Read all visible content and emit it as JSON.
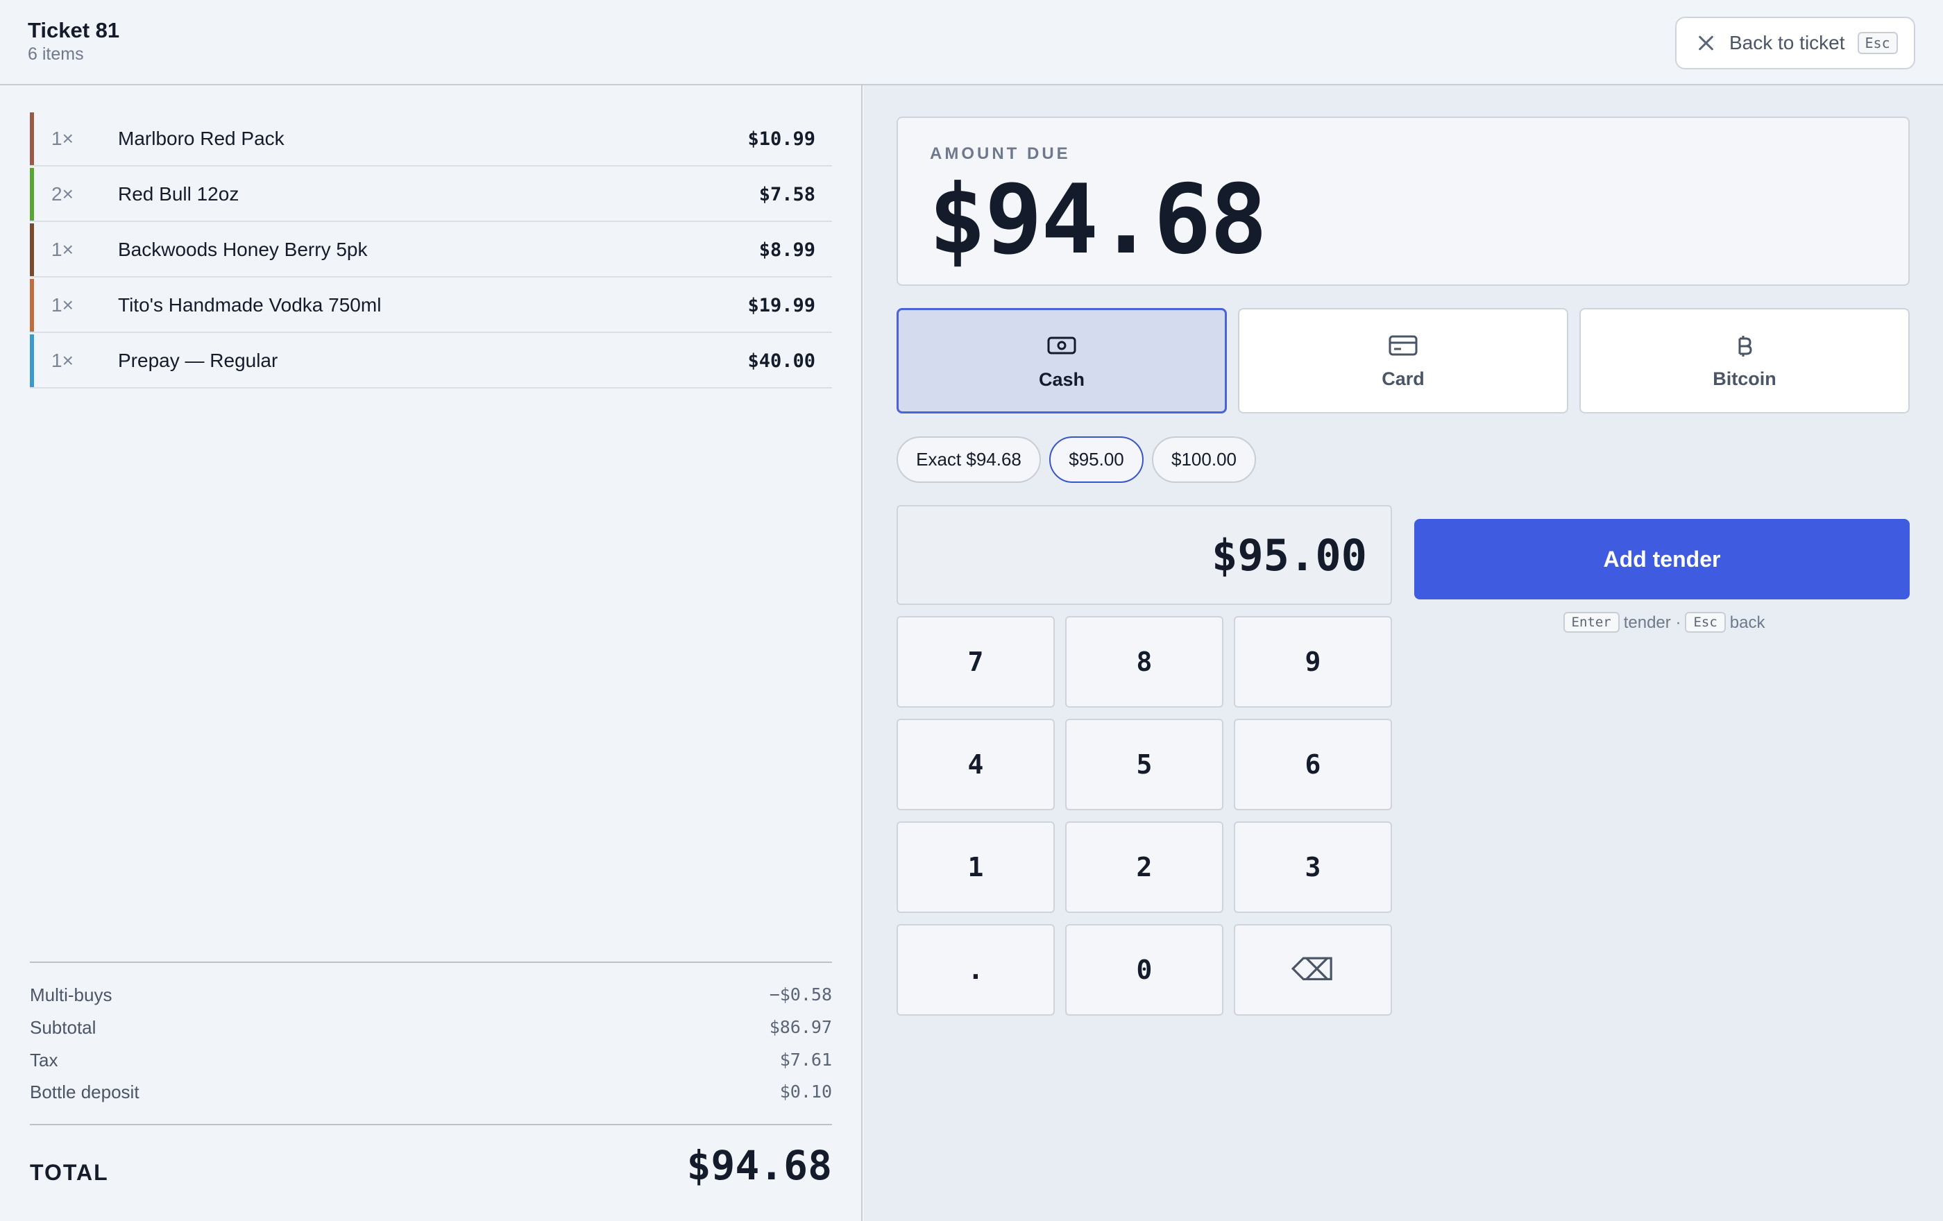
{
  "header": {
    "title": "Ticket 81",
    "subtitle": "6 items",
    "back_label": "Back to ticket",
    "back_key": "Esc"
  },
  "items": [
    {
      "qty": "1×",
      "name": "Marlboro Red Pack",
      "price": "$10.99",
      "color": "#9a5a48"
    },
    {
      "qty": "2×",
      "name": "Red Bull 12oz",
      "price": "$7.58",
      "color": "#5aa632"
    },
    {
      "qty": "1×",
      "name": "Backwoods Honey Berry 5pk",
      "price": "$8.99",
      "color": "#7a4a2c"
    },
    {
      "qty": "1×",
      "name": "Tito's Handmade Vodka 750ml",
      "price": "$19.99",
      "color": "#c26d3e"
    },
    {
      "qty": "1×",
      "name": "Prepay — Regular",
      "price": "$40.00",
      "color": "#3a9ad0"
    }
  ],
  "summary": {
    "multibuys_label": "Multi-buys",
    "multibuys_value": "−$0.58",
    "subtotal_label": "Subtotal",
    "subtotal_value": "$86.97",
    "tax_label": "Tax",
    "tax_value": "$7.61",
    "deposit_label": "Bottle deposit",
    "deposit_value": "$0.10",
    "total_label": "TOTAL",
    "total_value": "$94.68"
  },
  "amount_due": {
    "label": "AMOUNT DUE",
    "value": "$94.68"
  },
  "methods": [
    {
      "label": "Cash",
      "icon": "cash-icon",
      "selected": true
    },
    {
      "label": "Card",
      "icon": "card-icon",
      "selected": false
    },
    {
      "label": "Bitcoin",
      "icon": "bitcoin-icon",
      "selected": false
    }
  ],
  "quick_amounts": [
    {
      "label": "Exact $94.68",
      "selected": false
    },
    {
      "label": "$95.00",
      "selected": true
    },
    {
      "label": "$100.00",
      "selected": false
    }
  ],
  "entry_value": "$95.00",
  "keypad": [
    "7",
    "8",
    "9",
    "4",
    "5",
    "6",
    "1",
    "2",
    "3",
    ".",
    "0",
    "⌫"
  ],
  "add_tender_label": "Add tender",
  "hint": {
    "enter_key": "Enter",
    "enter_text": "tender ·",
    "esc_key": "Esc",
    "esc_text": "back"
  },
  "colors": {
    "accent": "#3f5ce0",
    "selected_method_bg": "#d4dbee"
  }
}
